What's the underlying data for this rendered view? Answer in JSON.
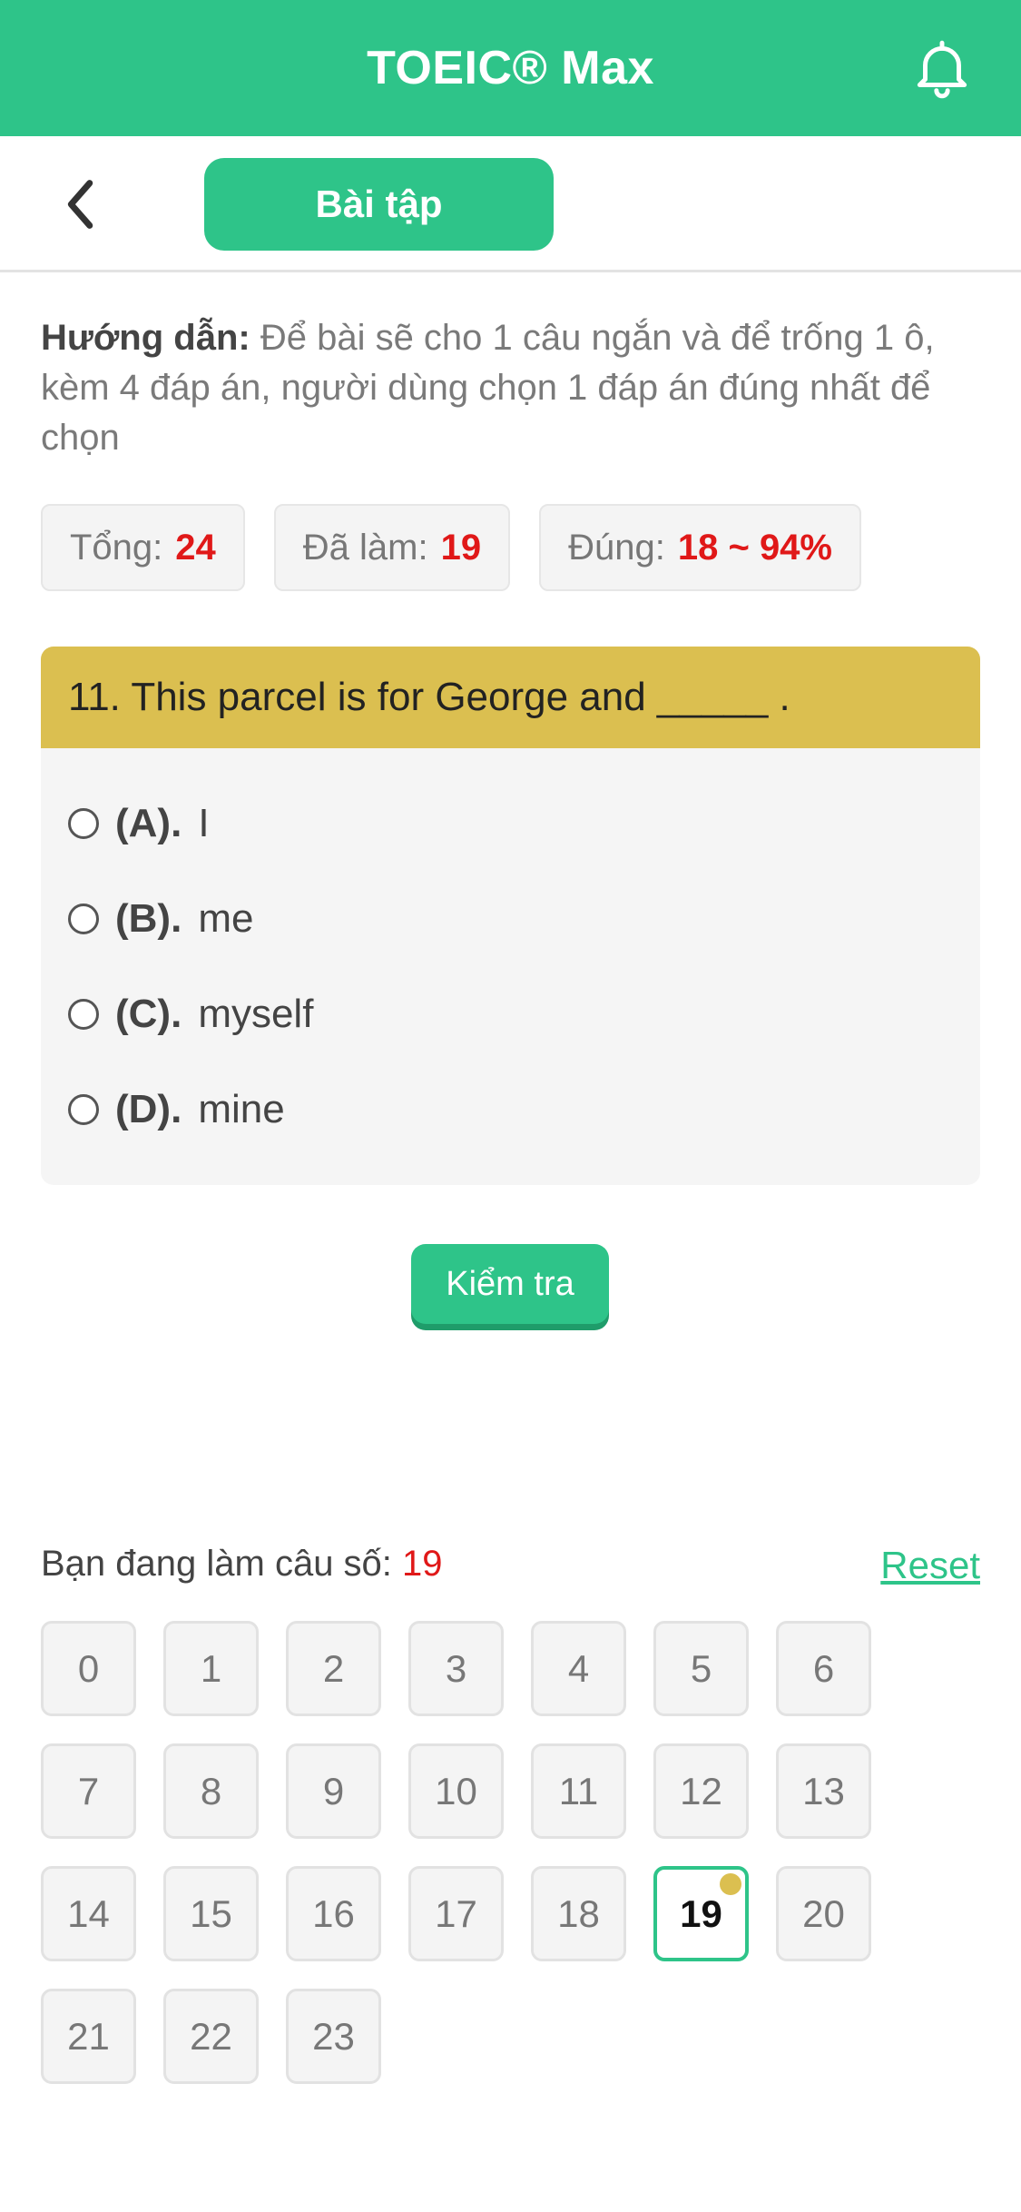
{
  "header": {
    "title": "TOEIC® Max"
  },
  "subnav": {
    "tab_label": "Bài tập"
  },
  "instructions": {
    "label": "Hướng dẫn:",
    "text": "Để bài sẽ cho 1 câu ngắn và để trống 1 ô, kèm 4 đáp án, người dùng chọn 1 đáp án đúng nhất để chọn"
  },
  "stats": {
    "total_label": "Tổng:",
    "total_value": "24",
    "done_label": "Đã làm:",
    "done_value": "19",
    "correct_label": "Đúng:",
    "correct_value": "18 ~ 94%"
  },
  "question": {
    "text": "11. This parcel is for George and _____ .",
    "options": [
      {
        "letter": "(A).",
        "text": "I"
      },
      {
        "letter": "(B).",
        "text": "me"
      },
      {
        "letter": "(C).",
        "text": "myself"
      },
      {
        "letter": "(D).",
        "text": "mine"
      }
    ]
  },
  "check_button": "Kiểm tra",
  "progress": {
    "label": "Bạn đang làm câu số:",
    "current": "19",
    "reset_label": "Reset",
    "cells": [
      "0",
      "1",
      "2",
      "3",
      "4",
      "5",
      "6",
      "7",
      "8",
      "9",
      "10",
      "11",
      "12",
      "13",
      "14",
      "15",
      "16",
      "17",
      "18",
      "19",
      "20",
      "21",
      "22",
      "23"
    ]
  },
  "colors": {
    "accent": "#2ec489",
    "question_bar": "#dbbf50",
    "highlight": "#e01818"
  }
}
